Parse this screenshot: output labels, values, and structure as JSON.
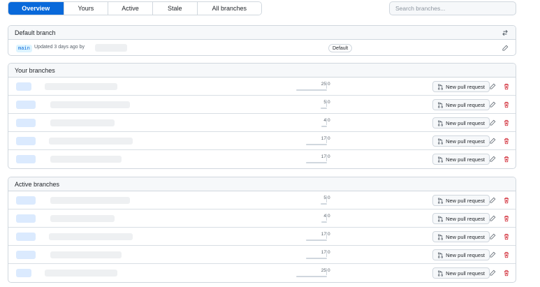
{
  "tabs": [
    {
      "label": "Overview",
      "selected": true
    },
    {
      "label": "Yours",
      "selected": false
    },
    {
      "label": "Active",
      "selected": false
    },
    {
      "label": "Stale",
      "selected": false
    },
    {
      "label": "All branches",
      "selected": false
    }
  ],
  "search": {
    "placeholder": "Search branches...",
    "value": ""
  },
  "default_branch": {
    "title": "Default branch",
    "header_icon": "arrow-switch-icon",
    "branch": "main",
    "updated_text": "Updated 3 days ago by",
    "badge": "Default",
    "edit_icon": "pencil-icon"
  },
  "your_branches": {
    "title": "Your branches",
    "rows": [
      {
        "behind": "25",
        "ahead": "0",
        "behind_fraction": 1.0,
        "pr_label": "New pull request"
      },
      {
        "behind": "5",
        "ahead": "0",
        "behind_fraction": 0.2,
        "pr_label": "New pull request"
      },
      {
        "behind": "4",
        "ahead": "0",
        "behind_fraction": 0.16,
        "pr_label": "New pull request"
      },
      {
        "behind": "17",
        "ahead": "0",
        "behind_fraction": 0.68,
        "pr_label": "New pull request"
      },
      {
        "behind": "17",
        "ahead": "0",
        "behind_fraction": 0.68,
        "pr_label": "New pull request"
      }
    ]
  },
  "active_branches": {
    "title": "Active branches",
    "rows": [
      {
        "behind": "5",
        "ahead": "0",
        "behind_fraction": 0.2,
        "pr_label": "New pull request"
      },
      {
        "behind": "4",
        "ahead": "0",
        "behind_fraction": 0.16,
        "pr_label": "New pull request"
      },
      {
        "behind": "17",
        "ahead": "0",
        "behind_fraction": 0.68,
        "pr_label": "New pull request"
      },
      {
        "behind": "17",
        "ahead": "0",
        "behind_fraction": 0.68,
        "pr_label": "New pull request"
      },
      {
        "behind": "25",
        "ahead": "0",
        "behind_fraction": 1.0,
        "pr_label": "New pull request"
      }
    ]
  },
  "colors": {
    "accent": "#0969da",
    "danger": "#cf222e",
    "border": "#d0d7de",
    "header_bg": "#f6f8fa"
  }
}
